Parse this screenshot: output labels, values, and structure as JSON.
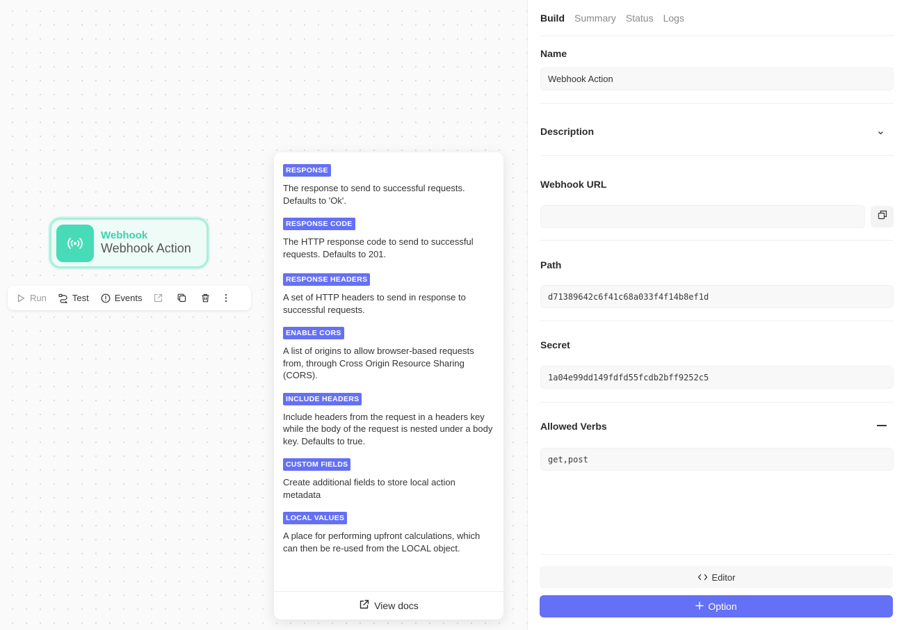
{
  "colors": {
    "accent": "#6470f5",
    "node_green": "#47dbb8",
    "node_border": "#a9eedb",
    "node_type_text": "#3cd3ad"
  },
  "node": {
    "type_label": "Webhook",
    "name": "Webhook Action",
    "icon": "broadcast-icon"
  },
  "toolbar": {
    "run": "Run",
    "test": "Test",
    "events": "Events"
  },
  "docs": {
    "items": [
      {
        "badge": "RESPONSE",
        "desc": "The response to send to successful requests. Defaults to 'Ok'."
      },
      {
        "badge": "RESPONSE CODE",
        "desc": "The HTTP response code to send to successful requests. Defaults to 201."
      },
      {
        "badge": "RESPONSE HEADERS",
        "desc": "A set of HTTP headers to send in response to successful requests."
      },
      {
        "badge": "ENABLE CORS",
        "desc": "A list of origins to allow browser-based requests from, through Cross Origin Resource Sharing (CORS)."
      },
      {
        "badge": "INCLUDE HEADERS",
        "desc": "Include headers from the request in a headers key while the body of the request is nested under a body key. Defaults to true."
      },
      {
        "badge": "CUSTOM FIELDS",
        "desc": "Create additional fields to store local action metadata"
      },
      {
        "badge": "LOCAL VALUES",
        "desc": "A place for performing upfront calculations, which can then be re-used from the LOCAL object."
      }
    ],
    "view_docs": "View docs"
  },
  "panel": {
    "tabs": [
      "Build",
      "Summary",
      "Status",
      "Logs"
    ],
    "name_label": "Name",
    "name_value": "Webhook Action",
    "description_label": "Description",
    "webhook_url_label": "Webhook URL",
    "webhook_url_value": "",
    "path_label": "Path",
    "path_value": "d71389642c6f41c68a033f4f14b8ef1d",
    "secret_label": "Secret",
    "secret_value": "1a04e99dd149fdfd55fcdb2bff9252c5",
    "verbs_label": "Allowed Verbs",
    "verbs_value": "get,post",
    "editor_btn": "Editor",
    "option_btn": "Option"
  }
}
